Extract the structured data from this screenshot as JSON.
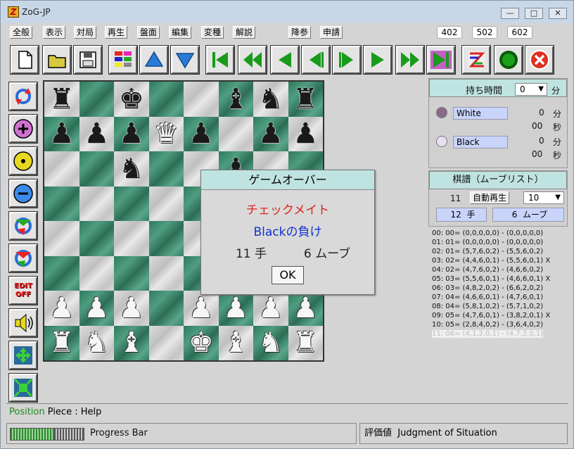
{
  "window": {
    "title": "ZoG-JP",
    "icon_letter": "Z"
  },
  "window_controls": {
    "minimize": "—",
    "maximize": "□",
    "close": "✕"
  },
  "menu": [
    "全般",
    "表示",
    "対局",
    "再生",
    "盤面",
    "編集",
    "変種",
    "解説",
    "降参",
    "申請"
  ],
  "board_sizes": [
    "402",
    "502",
    "602"
  ],
  "toolbar_icons": [
    "new-file-icon",
    "open-folder-icon",
    "save-disk-icon",
    "board-colors-icon",
    "arrow-up-icon",
    "arrow-down-icon",
    "first-move-icon",
    "back-fast-icon",
    "back-icon",
    "back-step-icon",
    "forward-step-icon",
    "forward-icon",
    "forward-fast-icon",
    "last-move-icon",
    "swap-sides-icon",
    "go-icon",
    "stop-icon"
  ],
  "side_icons": [
    "rotate-board-icon",
    "add-piece-icon",
    "center-piece-icon",
    "remove-piece-icon",
    "cycle-green-icon",
    "cycle-red-icon",
    "edit-off-icon",
    "sound-icon",
    "expand-icon",
    "shrink-icon"
  ],
  "side_edit_label": "EDIT OFF",
  "board": {
    "rows": [
      [
        "",
        "bR",
        "",
        "bK",
        "",
        "",
        "bB",
        "bN",
        "bR"
      ],
      [
        "bP",
        "bP",
        "bP",
        "wQ",
        "bP",
        "",
        "bP",
        "bP"
      ],
      [
        "",
        "",
        "bN",
        "",
        "",
        "bP",
        "",
        ""
      ],
      [
        "",
        "",
        "",
        "",
        "",
        "",
        "",
        ""
      ],
      [
        "",
        "",
        "",
        "",
        "",
        "",
        "",
        ""
      ],
      [
        "",
        "",
        "",
        "",
        "",
        "",
        "",
        ""
      ],
      [
        "wP",
        "wP",
        "wP",
        "",
        "wP",
        "wP",
        "wP",
        "wP"
      ],
      [
        "wR",
        "wN",
        "wB",
        "",
        "wK",
        "wB",
        "wN",
        "wR"
      ]
    ]
  },
  "time_panel": {
    "header": "持ち時間",
    "minutes_value": "0",
    "minutes_unit": "分",
    "white": {
      "name": "White",
      "min": "0",
      "min_unit": "分",
      "sec": "00",
      "sec_unit": "秒"
    },
    "black": {
      "name": "Black",
      "min": "0",
      "min_unit": "分",
      "sec": "00",
      "sec_unit": "秒"
    }
  },
  "record_panel": {
    "header": "棋譜（ムーブリスト）",
    "index": "11",
    "autoplay_label": "自動再生",
    "speed": "10",
    "moves_count": "12",
    "moves_unit": "手",
    "turns_count": "6",
    "turns_unit": "ムーブ"
  },
  "move_list": [
    "00: 00= (0,0,0,0,0) - (0,0,0,0,0)",
    "01: 01= (0,0,0,0,0) - (0,0,0,0,0)",
    "02: 01= (5,7,6,0,2) - (5,5,6,0,2)",
    "03: 02= (4,4,6,0,1) - (5,5,6,0,1) X",
    "04: 02= (4,7,6,0,2) - (4,6,6,0,2)",
    "05: 03= (5,5,6,0,1) - (4,6,6,0,1) X",
    "06: 03= (4,8,2,0,2) - (6,6,2,0,2)",
    "07: 04= (4,6,6,0,1) - (4,7,6,0,1)",
    "08: 04= (5,8,1,0,2) - (5,7,1,0,2)",
    "09: 05= (4,7,6,0,1) - (3,8,2,0,1) X",
    "10: 05= (2,8,4,0,2) - (3,6,4,0,2)",
    "11: 06= (4,1,2,0,1) - (4,7,2,0,1)"
  ],
  "dialog": {
    "title": "ゲームオーバー",
    "result": "チェックメイト",
    "loser": "Blackの負け",
    "moves": "11 手",
    "turns": "6 ムーブ",
    "ok": "OK"
  },
  "status": {
    "position": "Position",
    "piece_help": "Piece : Help",
    "progress_label": "Progress Bar",
    "progress_fraction": 0.6,
    "eval_label": "評価値",
    "eval_text": "Judgment of Situation"
  },
  "colors": {
    "dialog_result": "#e0201c",
    "dialog_loser": "#1030d0",
    "position_green": "#1a8a1a",
    "header_teal": "#bfe3e0"
  }
}
